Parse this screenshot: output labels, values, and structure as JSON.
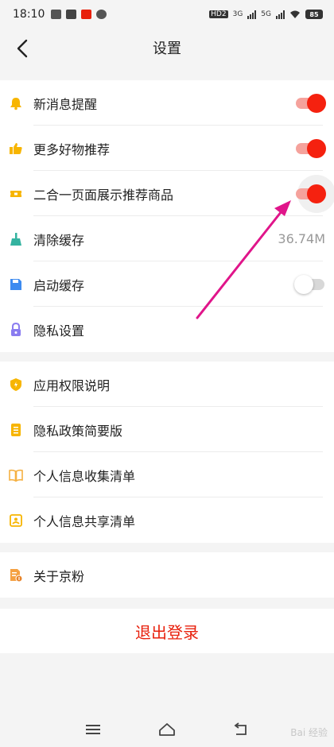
{
  "status_bar": {
    "time": "18:10",
    "network_labels": [
      "HD2",
      "3G",
      "5G"
    ],
    "battery": "85"
  },
  "header": {
    "title": "设置"
  },
  "settings_group": {
    "items": [
      {
        "label": "新消息提醒",
        "icon": "bell-icon",
        "control": "toggle",
        "on": true
      },
      {
        "label": "更多好物推荐",
        "icon": "thumbs-up-icon",
        "control": "toggle",
        "on": true
      },
      {
        "label": "二合一页面展示推荐商品",
        "icon": "ticket-icon",
        "control": "toggle",
        "on": true
      },
      {
        "label": "清除缓存",
        "icon": "broom-icon",
        "control": "value",
        "value": "36.74M"
      },
      {
        "label": "启动缓存",
        "icon": "floppy-icon",
        "control": "toggle",
        "on": false
      },
      {
        "label": "隐私设置",
        "icon": "lock-icon",
        "control": "none"
      }
    ]
  },
  "policy_group": {
    "items": [
      {
        "label": "应用权限说明",
        "icon": "shield-icon"
      },
      {
        "label": "隐私政策简要版",
        "icon": "list-doc-icon"
      },
      {
        "label": "个人信息收集清单",
        "icon": "open-book-icon"
      },
      {
        "label": "个人信息共享清单",
        "icon": "share-doc-icon"
      }
    ]
  },
  "about_group": {
    "items": [
      {
        "label": "关于京粉",
        "icon": "info-doc-icon"
      }
    ]
  },
  "logout_label": "退出登录",
  "navbar": {
    "icons": [
      "menu-icon",
      "home-icon",
      "back-nav-icon"
    ]
  },
  "watermark": "Bai 经验",
  "colors": {
    "accent_red": "#f5210f",
    "toggle_track_on": "#f5a29c",
    "arrow": "#e0158a",
    "icon_yellow": "#f7b500",
    "icon_teal": "#34b3a0",
    "icon_blue": "#3d8bf0",
    "icon_purple": "#8a7cf0"
  }
}
